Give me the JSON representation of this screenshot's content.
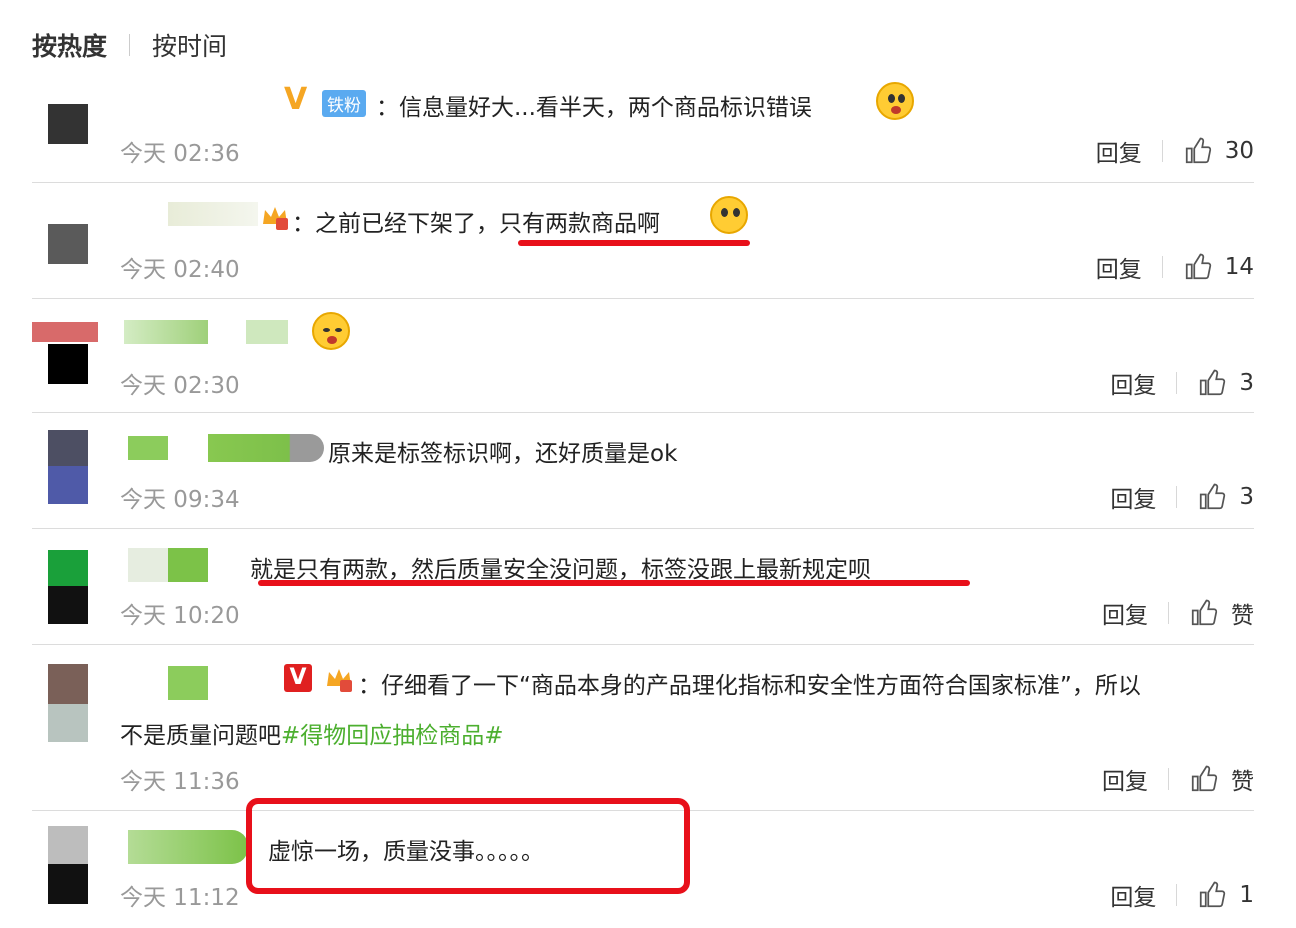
{
  "sort": {
    "hot": "按热度",
    "time": "按时间"
  },
  "reply_label": "回复",
  "comments": [
    {
      "text": "：信息量好大...看半天，两个商品标识错误",
      "time": "今天 02:36",
      "likes": "30",
      "badge_fan": "铁粉"
    },
    {
      "text": "：之前已经下架了，只有两款商品啊",
      "time": "今天 02:40",
      "likes": "14"
    },
    {
      "text": "",
      "time": "今天 02:30",
      "likes": "3"
    },
    {
      "text": "原来是标签标识啊，还好质量是ok",
      "time": "今天 09:34",
      "likes": "3"
    },
    {
      "text": "就是只有两款，然后质量安全没问题，标签没跟上最新规定呗",
      "time": "今天 10:20",
      "likes": "赞"
    },
    {
      "text": "：仔细看了一下“商品本身的产品理化指标和安全性方面符合国家标准”，所以",
      "text2": "不是质量问题吧",
      "topic": "#得物回应抽检商品#",
      "time": "今天 11:36",
      "likes": "赞"
    },
    {
      "text": "虚惊一场，质量没事。。。。。",
      "time": "今天 11:12",
      "likes": "1"
    }
  ],
  "colors": {
    "accent_red": "#e8101a",
    "topic_green": "#4caf2f",
    "time_gray": "#999999"
  }
}
